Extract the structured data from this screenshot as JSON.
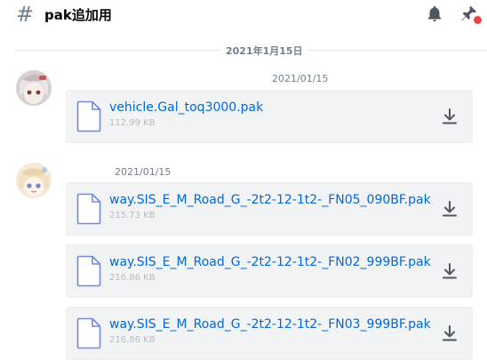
{
  "header": {
    "hash_symbol": "#",
    "channel_name": "pak追加用"
  },
  "divider": {
    "date": "2021年1月15日"
  },
  "messages": [
    {
      "timestamp": "2021/01/15",
      "attachments": [
        {
          "name": "vehicle.Gal_toq3000.pak",
          "size": "112.99 KB"
        }
      ]
    },
    {
      "timestamp": "2021/01/15",
      "attachments": [
        {
          "name": "way.SIS_E_M_Road_G_-2t2-12-1t2-_FN05_090BF.pak",
          "size": "215.73 KB"
        },
        {
          "name": "way.SIS_E_M_Road_G_-2t2-12-1t2-_FN02_999BF.pak",
          "size": "216.86 KB"
        },
        {
          "name": "way.SIS_E_M_Road_G_-2t2-12-1t2-_FN03_999BF.pak",
          "size": "216.86 KB"
        }
      ]
    }
  ],
  "colors": {
    "link": "#0068e0",
    "muted": "#747f8d",
    "attachment_bg": "#f2f3f5",
    "notification_dot": "#ed4245"
  },
  "icons": [
    "bell-icon",
    "pin-icon",
    "file-icon",
    "download-icon"
  ]
}
